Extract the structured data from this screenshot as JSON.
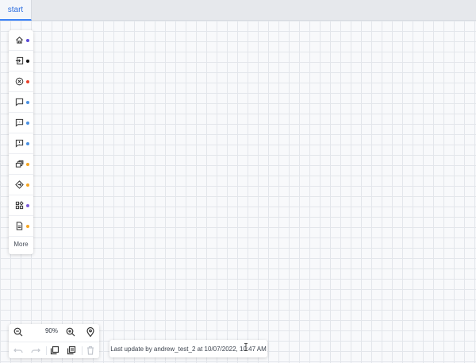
{
  "tabs": [
    {
      "label": "start",
      "active": true
    }
  ],
  "palette": {
    "items": [
      {
        "icon": "home-icon",
        "dot_color": "#5b4bd8"
      },
      {
        "icon": "enter-icon",
        "dot_color": "#111111"
      },
      {
        "icon": "close-circle-icon",
        "dot_color": "#e8412c"
      },
      {
        "icon": "message-icon",
        "dot_color": "#4a90e2"
      },
      {
        "icon": "message-text-icon",
        "dot_color": "#4a90e2"
      },
      {
        "icon": "message-alert-icon",
        "dot_color": "#4a90e2"
      },
      {
        "icon": "cards-icon",
        "dot_color": "#f5a623"
      },
      {
        "icon": "diamond-icon",
        "dot_color": "#f5a623"
      },
      {
        "icon": "widgets-icon",
        "dot_color": "#7b5bd8"
      },
      {
        "icon": "document-icon",
        "dot_color": "#f5a623"
      }
    ],
    "more_label": "More"
  },
  "zoombar": {
    "zoom_level": "90%",
    "icons": [
      "zoom-out-icon",
      "zoom-in-icon",
      "location-icon",
      "undo-icon",
      "redo-icon",
      "copy-icon",
      "paste-icon",
      "delete-icon"
    ]
  },
  "status": {
    "text": "Last update by andrew_test_2 at 10/07/2022, 10:47 AM"
  },
  "colors": {
    "accent": "#3b82f6",
    "grid_line": "#e3e6eb",
    "canvas_bg": "#f8f9fb"
  }
}
